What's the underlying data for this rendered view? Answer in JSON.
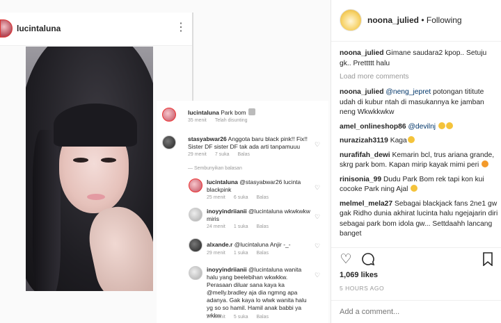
{
  "left": {
    "username": "lucintaluna"
  },
  "inset": {
    "caption_user": "lucintaluna",
    "caption_text": "Park bom",
    "caption_meta_time": "35 menit",
    "caption_meta_edited": "Telah disunting",
    "comments": [
      {
        "user": "stasyabwar26",
        "text": "Anggota baru black pink!! Fix!! Sister DF sister DF tak ada arti tanpamuuu",
        "time": "29 menit",
        "likes": "7 suka",
        "reply": "Balas"
      },
      {
        "user": "lucintaluna",
        "text": "@stasyabwar26 lucinta blackpink",
        "time": "25 menit",
        "likes": "6 suka",
        "reply": "Balas"
      },
      {
        "user": "inoyyindriianii",
        "text": "@lucintaluna wkwkwkw miris",
        "time": "24 menit",
        "likes": "1 suka",
        "reply": "Balas"
      },
      {
        "user": "alxande.r",
        "text": "@lucintaluna Anjir -_-",
        "time": "29 menit",
        "likes": "1 suka",
        "reply": "Balas"
      },
      {
        "user": "inoyyindriianii",
        "text": "@lucintaluna wanita halu yang beelebihan wkwkkw. Perasaan diluar sana kaya ka @melly.bradley aja dia ngmng apa adanya. Gak kaya lo wlwk wanita halu yg so so hamil. Hamil anak babbi ya wkkw",
        "time": "24 menit",
        "likes": "5 suka",
        "reply": "Balas"
      }
    ],
    "hide_replies": "Sembunyikan balasan"
  },
  "post": {
    "username": "noona_julied",
    "follow_status": "Following",
    "load_more": "Load more comments",
    "comments": [
      {
        "user": "noona_julied",
        "text": "Gimane saudara2 kpop.. Setuju gk.. Prettttt halu"
      },
      {
        "user": "noona_julied",
        "mention": "@neng_jepret",
        "text": "potongan tititute udah di kubur ntah di masukannya ke jamban neng Wkwkkwkw"
      },
      {
        "user": "amel_onlineshop86",
        "mention": "@devilnj",
        "text": ""
      },
      {
        "user": "nurazizah3119",
        "text": "Kaga"
      },
      {
        "user": "nurafifah_dewi",
        "text": "Kemarin bcl, trus ariana grande, skrg park bom. Kapan mirip kayak mimi peri"
      },
      {
        "user": "rinisonia_99",
        "text": "Dudu Park Bom rek tapi kon kui cocoke Park ning Ajal"
      },
      {
        "user": "melmel_mela27",
        "text": "Sebagai blackjack fans 2ne1 gw gak Ridho dunia akhirat lucinta halu ngejajarin diri sebagai park bom idola gw... Settdaahh lancang banget"
      }
    ],
    "likes": "1,069 likes",
    "time_ago": "5 HOURS AGO",
    "add_comment_placeholder": "Add a comment..."
  }
}
